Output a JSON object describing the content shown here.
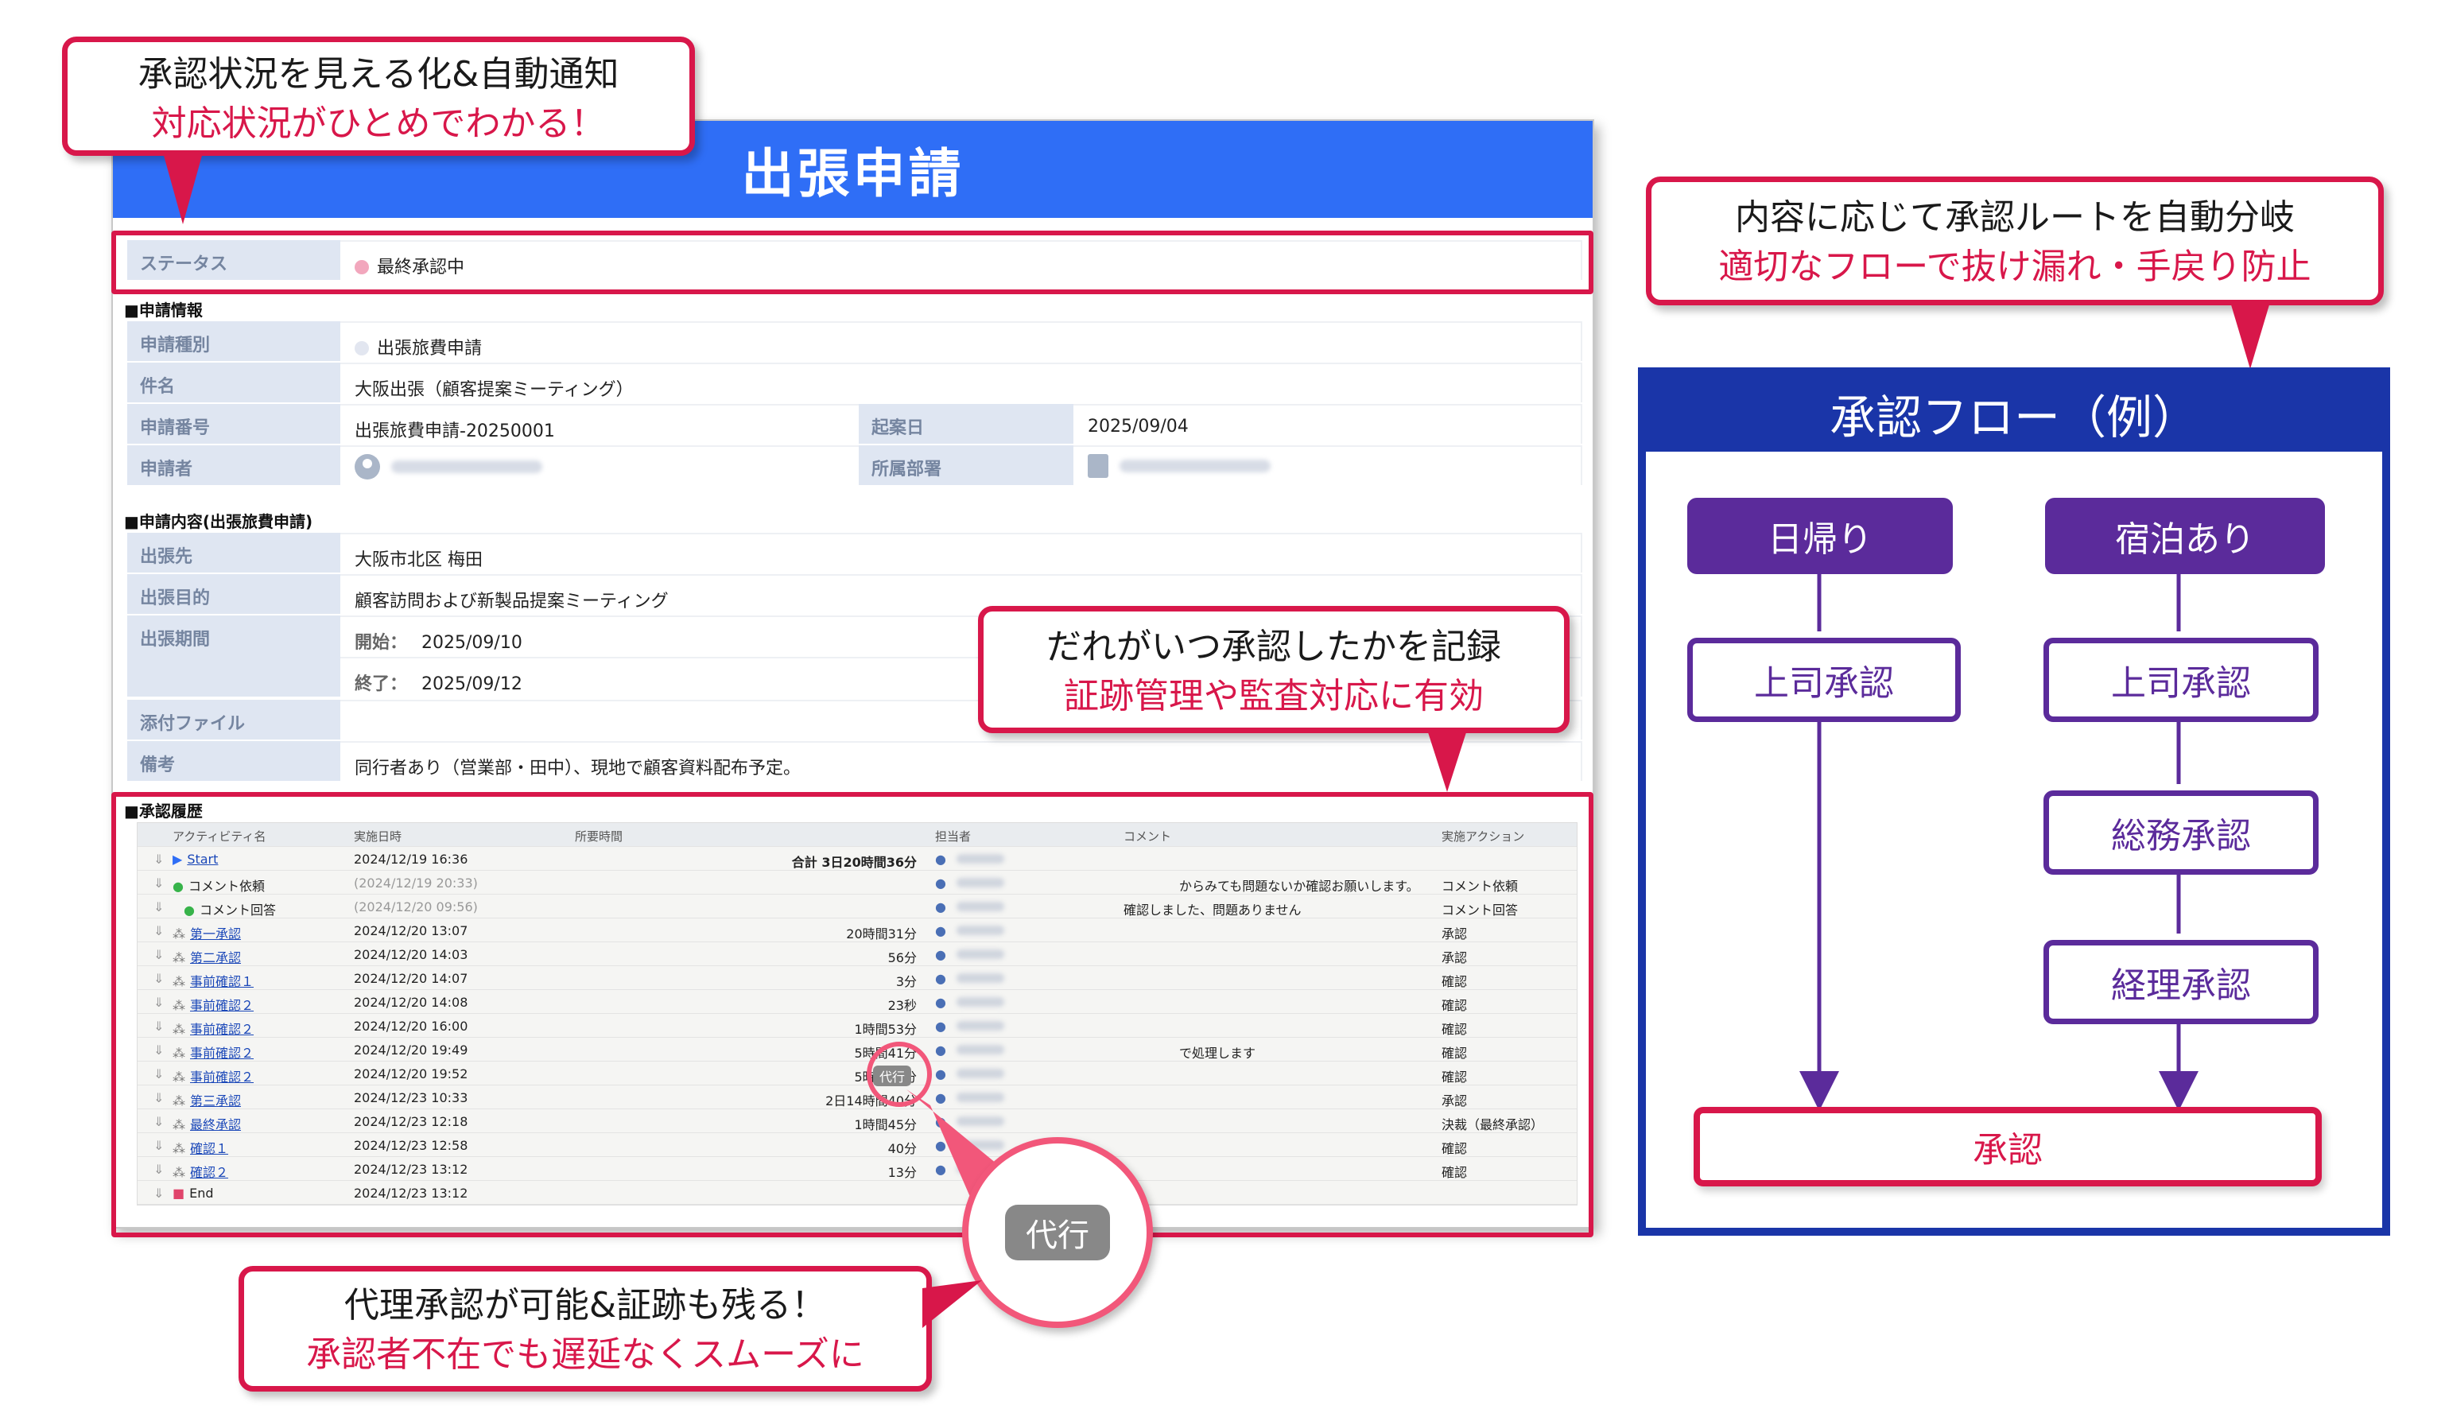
{
  "callouts": {
    "top_left": {
      "line1": "承認状況を見える化&自動通知",
      "line2": "対応状況がひとめでわかる！"
    },
    "middle": {
      "line1": "だれがいつ承認したかを記録",
      "line2": "証跡管理や監査対応に有効"
    },
    "bottom": {
      "line1": "代理承認が可能&証跡も残る！",
      "line2": "承認者不在でも遅延なくスムーズに"
    },
    "right": {
      "line1": "内容に応じて承認ルートを自動分岐",
      "line2": "適切なフローで抜け漏れ・手戻り防止"
    }
  },
  "form": {
    "title": "出張申請",
    "status": {
      "label": "ステータス",
      "value": "最終承認中",
      "dot_color": "#f2a7bd"
    },
    "section_info": "■申請情報",
    "info": {
      "type_label": "申請種別",
      "type_value": "出張旅費申請",
      "type_dot_color": "#e2e6f0",
      "subject_label": "件名",
      "subject_value": "大阪出張（顧客提案ミーティング）",
      "number_label": "申請番号",
      "number_value": "出張旅費申請-20250001",
      "date_label": "起案日",
      "date_value": "2025/09/04",
      "applicant_label": "申請者",
      "dept_label": "所属部署"
    },
    "section_content": "■申請内容(出張旅費申請)",
    "content": {
      "dest_label": "出張先",
      "dest_value": "大阪市北区 梅田",
      "purpose_label": "出張目的",
      "purpose_value": "顧客訪問および新製品提案ミーティング",
      "period_label": "出張期間",
      "start_label": "開始：",
      "start_value": "2025/09/10",
      "end_label": "終了：",
      "end_value": "2025/09/12",
      "attach_label": "添付ファイル",
      "note_label": "備考",
      "note_value": "同行者あり（営業部・田中）、現地で顧客資料配布予定。"
    },
    "section_history": "■承認履歴",
    "history_headers": {
      "activity": "アクティビティ名",
      "date": "実施日時",
      "duration": "所要時間",
      "user": "担当者",
      "comment": "コメント",
      "action": "実施アクション"
    },
    "history": [
      {
        "activity": "Start",
        "date": "2024/12/19 16:36",
        "duration": "合計 3日20時間36分",
        "comment": "",
        "action": ""
      },
      {
        "activity": "コメント依頼",
        "date": "(2024/12/19 20:33)",
        "duration": "",
        "comment": "からみても問題ないか確認お願いします。",
        "action": "コメント依頼"
      },
      {
        "activity": "コメント回答",
        "date": "(2024/12/20 09:56)",
        "duration": "",
        "comment": "確認しました、問題ありません",
        "action": "コメント回答"
      },
      {
        "activity": "第一承認",
        "date": "2024/12/20 13:07",
        "duration": "20時間31分",
        "comment": "",
        "action": "承認"
      },
      {
        "activity": "第二承認",
        "date": "2024/12/20 14:03",
        "duration": "56分",
        "comment": "",
        "action": "承認"
      },
      {
        "activity": "事前確認１",
        "date": "2024/12/20 14:07",
        "duration": "3分",
        "comment": "",
        "action": "確認"
      },
      {
        "activity": "事前確認２",
        "date": "2024/12/20 14:08",
        "duration": "23秒",
        "comment": "",
        "action": "確認"
      },
      {
        "activity": "事前確認２",
        "date": "2024/12/20 16:00",
        "duration": "1時間53分",
        "comment": "",
        "action": "確認"
      },
      {
        "activity": "事前確認２",
        "date": "2024/12/20 19:49",
        "duration": "5時間41分",
        "comment": "で処理します",
        "action": "確認"
      },
      {
        "activity": "事前確認２",
        "date": "2024/12/20 19:52",
        "duration": "5時間45分",
        "comment": "",
        "action": "確認"
      },
      {
        "activity": "第三承認",
        "date": "2024/12/23 10:33",
        "duration": "2日14時間40分",
        "comment": "",
        "action": "承認"
      },
      {
        "activity": "最終承認",
        "date": "2024/12/23 12:18",
        "duration": "1時間45分",
        "comment": "",
        "action": "決裁（最終承認）"
      },
      {
        "activity": "確認１",
        "date": "2024/12/23 12:58",
        "duration": "40分",
        "comment": "",
        "action": "確認"
      },
      {
        "activity": "確認２",
        "date": "2024/12/23 13:12",
        "duration": "13分",
        "comment": "",
        "action": "確認"
      },
      {
        "activity": "End",
        "date": "2024/12/23 13:12",
        "duration": "",
        "comment": "",
        "action": ""
      }
    ],
    "proxy_tag": "代行"
  },
  "flow": {
    "title": "承認フロー（例）",
    "left_start": "日帰り",
    "right_start": "宿泊あり",
    "left_step1": "上司承認",
    "right_step1": "上司承認",
    "right_step2": "総務承認",
    "right_step3": "経理承認",
    "final": "承認",
    "colors": {
      "node": "#5b2b9b",
      "panel": "#1a35a8",
      "accent": "#d8174a"
    }
  }
}
